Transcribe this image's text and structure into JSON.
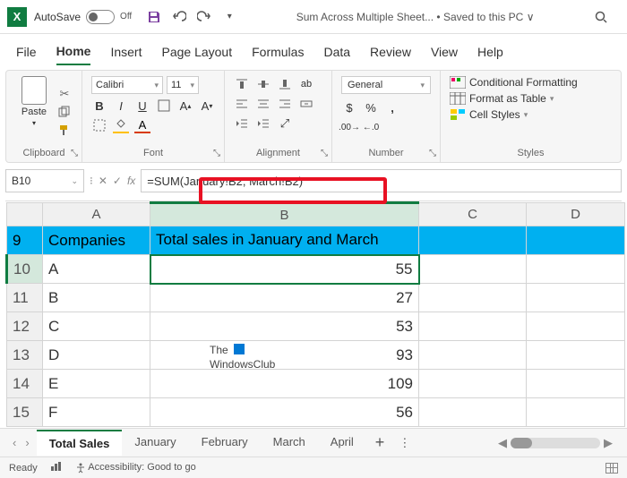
{
  "title_bar": {
    "autosave_label": "AutoSave",
    "autosave_state": "Off",
    "document_title": "Sum Across Multiple Sheet...",
    "saved_status": "Saved to this PC",
    "saved_suffix": "∨"
  },
  "menu": [
    "File",
    "Home",
    "Insert",
    "Page Layout",
    "Formulas",
    "Data",
    "Review",
    "View",
    "Help"
  ],
  "menu_active": "Home",
  "ribbon": {
    "clipboard": {
      "label": "Clipboard",
      "paste": "Paste"
    },
    "font": {
      "label": "Font",
      "name": "Calibri",
      "size": "11",
      "bold": "B",
      "italic": "I",
      "underline": "U"
    },
    "alignment": {
      "label": "Alignment"
    },
    "number": {
      "label": "Number",
      "format": "General"
    },
    "styles": {
      "label": "Styles",
      "conditional": "Conditional Formatting",
      "table": "Format as Table",
      "cell": "Cell Styles"
    }
  },
  "formula_bar": {
    "name_box": "B10",
    "formula": "=SUM(January!B2, March!B2)"
  },
  "columns": [
    "A",
    "B",
    "C",
    "D"
  ],
  "rows": [
    {
      "num": "9",
      "a": "Companies",
      "b": "Total sales in January and March",
      "header": true
    },
    {
      "num": "10",
      "a": "A",
      "b": "55",
      "selected": true
    },
    {
      "num": "11",
      "a": "B",
      "b": "27"
    },
    {
      "num": "12",
      "a": "C",
      "b": "53"
    },
    {
      "num": "13",
      "a": "D",
      "b": "93"
    },
    {
      "num": "14",
      "a": "E",
      "b": "109"
    },
    {
      "num": "15",
      "a": "F",
      "b": "56"
    }
  ],
  "watermark": {
    "line1": "The",
    "line2": "WindowsClub"
  },
  "sheet_tabs": [
    "Total Sales",
    "January",
    "February",
    "March",
    "April"
  ],
  "sheet_active": "Total Sales",
  "status": {
    "ready": "Ready",
    "accessibility": "Accessibility: Good to go"
  }
}
